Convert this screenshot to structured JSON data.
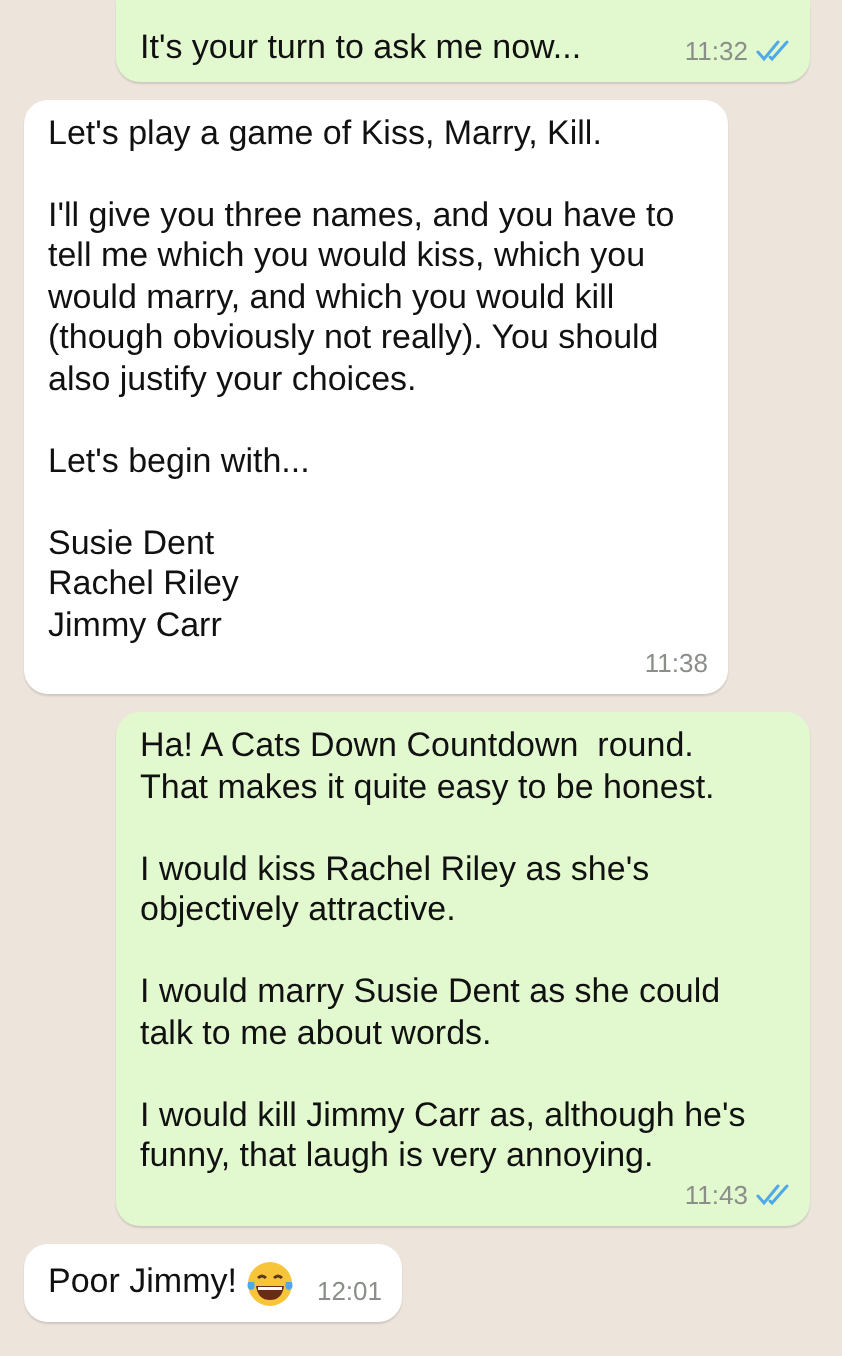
{
  "messages": [
    {
      "kind": "sent",
      "paragraphs": [
        "It's your turn to ask me now..."
      ],
      "time": "11:32",
      "read": true
    },
    {
      "kind": "received",
      "paragraphs": [
        "Let's play a game of Kiss, Marry, Kill.",
        "I'll give you three names, and you have to tell me which you would kiss, which you would marry, and which you would kill (though obviously not really). You should also justify your choices.",
        "Let's begin with...",
        "Susie Dent\nRachel Riley\nJimmy Carr"
      ],
      "time": "11:38"
    },
    {
      "kind": "sent",
      "paragraphs": [
        "Ha! A Cats Down Countdown  round. That makes it quite easy to be honest.",
        "I would kiss Rachel Riley as she's objectively attractive.",
        "I would marry Susie Dent as she could talk to me about words.",
        "I would kill Jimmy Carr as, although he's funny, that laugh is very annoying."
      ],
      "time": "11:43",
      "read": true
    },
    {
      "kind": "received",
      "paragraphs": [
        "Poor Jimmy!"
      ],
      "laughing_emoji": true,
      "time": "12:01"
    }
  ]
}
